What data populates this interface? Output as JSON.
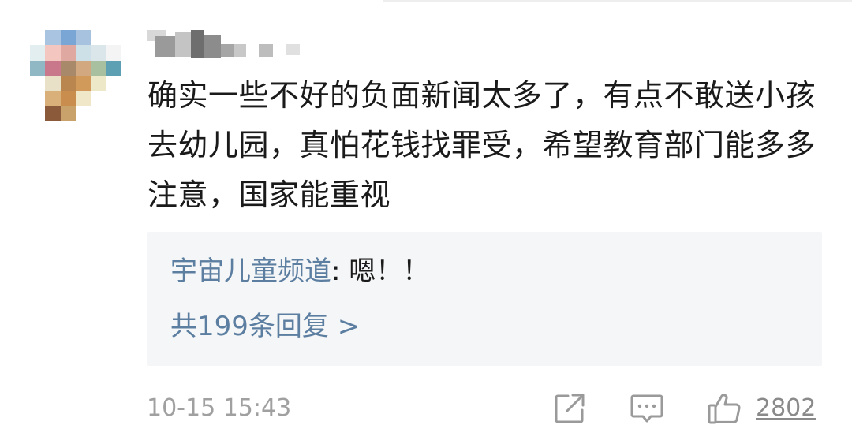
{
  "comment": {
    "text": "确实一些不好的负面新闻太多了，有点不敢送小孩去幼儿园，真怕花钱找罪受，希望教育部门能多多注意，国家能重视",
    "timestamp": "10-15 15:43",
    "like_count": "2802"
  },
  "reply_preview": {
    "author": "宇宙儿童频道",
    "separator": ": ",
    "text": "嗯！！",
    "total_replies": "共199条回复 >"
  },
  "actions": {
    "share_icon": "share-icon",
    "comment_icon": "comment-icon",
    "like_icon": "thumbs-up-icon"
  },
  "colors": {
    "reply_author": "#5b7ea1",
    "body_text": "#1a1a1a",
    "meta_text": "#a0a0a0",
    "reply_background": "#f5f6f7"
  }
}
